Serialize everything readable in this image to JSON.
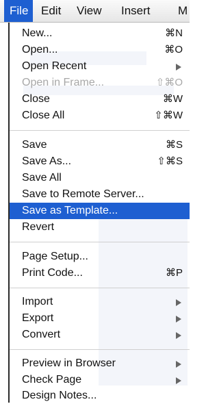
{
  "menubar": {
    "items": [
      {
        "label": "File",
        "active": true
      },
      {
        "label": "Edit",
        "active": false
      },
      {
        "label": "View",
        "active": false
      },
      {
        "label": "Insert",
        "active": false
      },
      {
        "label": "M",
        "active": false
      }
    ]
  },
  "file_menu": {
    "items": [
      {
        "label": "New...",
        "shortcut": "⌘N"
      },
      {
        "label": "Open...",
        "shortcut": "⌘O"
      },
      {
        "label": "Open Recent",
        "submenu": true
      },
      {
        "label": "Open in Frame...",
        "shortcut": "⇧⌘O",
        "disabled": true
      },
      {
        "label": "Close",
        "shortcut": "⌘W"
      },
      {
        "label": "Close All",
        "shortcut": "⇧⌘W"
      },
      {
        "label": "Save",
        "shortcut": "⌘S"
      },
      {
        "label": "Save As...",
        "shortcut": "⇧⌘S"
      },
      {
        "label": "Save All"
      },
      {
        "label": "Save to Remote Server..."
      },
      {
        "label": "Save as Template...",
        "highlighted": true
      },
      {
        "label": "Revert"
      },
      {
        "label": "Page Setup..."
      },
      {
        "label": "Print Code...",
        "shortcut": "⌘P"
      },
      {
        "label": "Import",
        "submenu": true
      },
      {
        "label": "Export",
        "submenu": true
      },
      {
        "label": "Convert",
        "submenu": true
      },
      {
        "label": "Preview in Browser",
        "submenu": true
      },
      {
        "label": "Check Page",
        "submenu": true
      },
      {
        "label": "Design Notes..."
      }
    ]
  },
  "colors": {
    "highlight": "#1e5fd1",
    "disabled_text": "#a8a8a8"
  }
}
